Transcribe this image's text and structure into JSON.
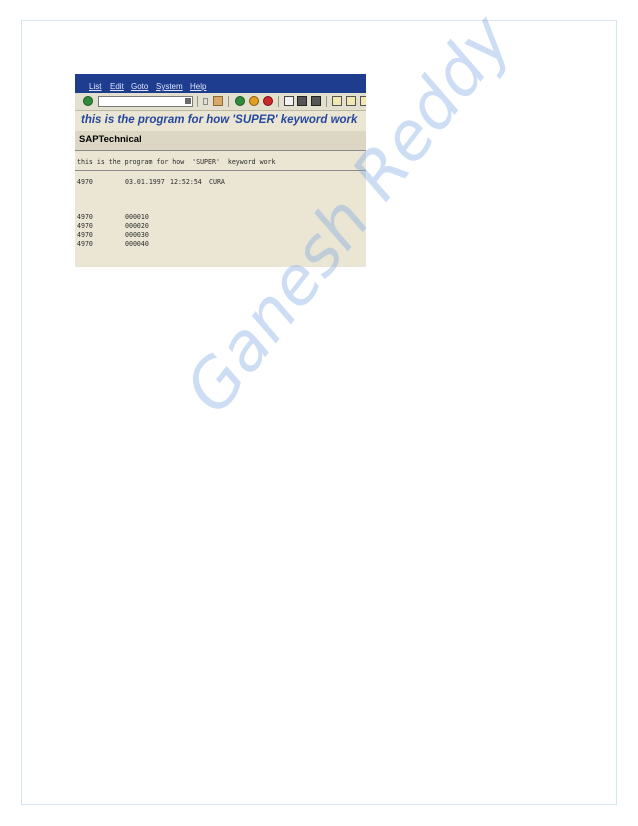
{
  "menu": {
    "items": [
      "List",
      "Edit",
      "Goto",
      "System",
      "Help"
    ]
  },
  "toolbar": {
    "icons": [
      "enter-icon",
      "save-icon",
      "back-icon",
      "exit-icon",
      "cancel-icon",
      "print-icon",
      "find-icon",
      "find-next-icon",
      "first-page-icon",
      "previous-page-icon"
    ]
  },
  "screen": {
    "title": "this is the program for how  'SUPER'  keyword work",
    "header": "SAPTechnical"
  },
  "list": {
    "heading": "this is the program for how  'SUPER'  keyword work",
    "info": {
      "id": "4970",
      "date": "03.01.1997",
      "time": "12:52:54",
      "user": "CURA"
    },
    "rows": [
      {
        "id": "4970",
        "value": "000010"
      },
      {
        "id": "4970",
        "value": "000020"
      },
      {
        "id": "4970",
        "value": "000030"
      },
      {
        "id": "4970",
        "value": "000040"
      }
    ]
  },
  "watermark": "Ganesh Reddy",
  "colors": {
    "menubar": "#1f3d8f",
    "title": "#26499e",
    "screen_bg": "#ebe6d4",
    "watermark": "#78a5e1"
  }
}
